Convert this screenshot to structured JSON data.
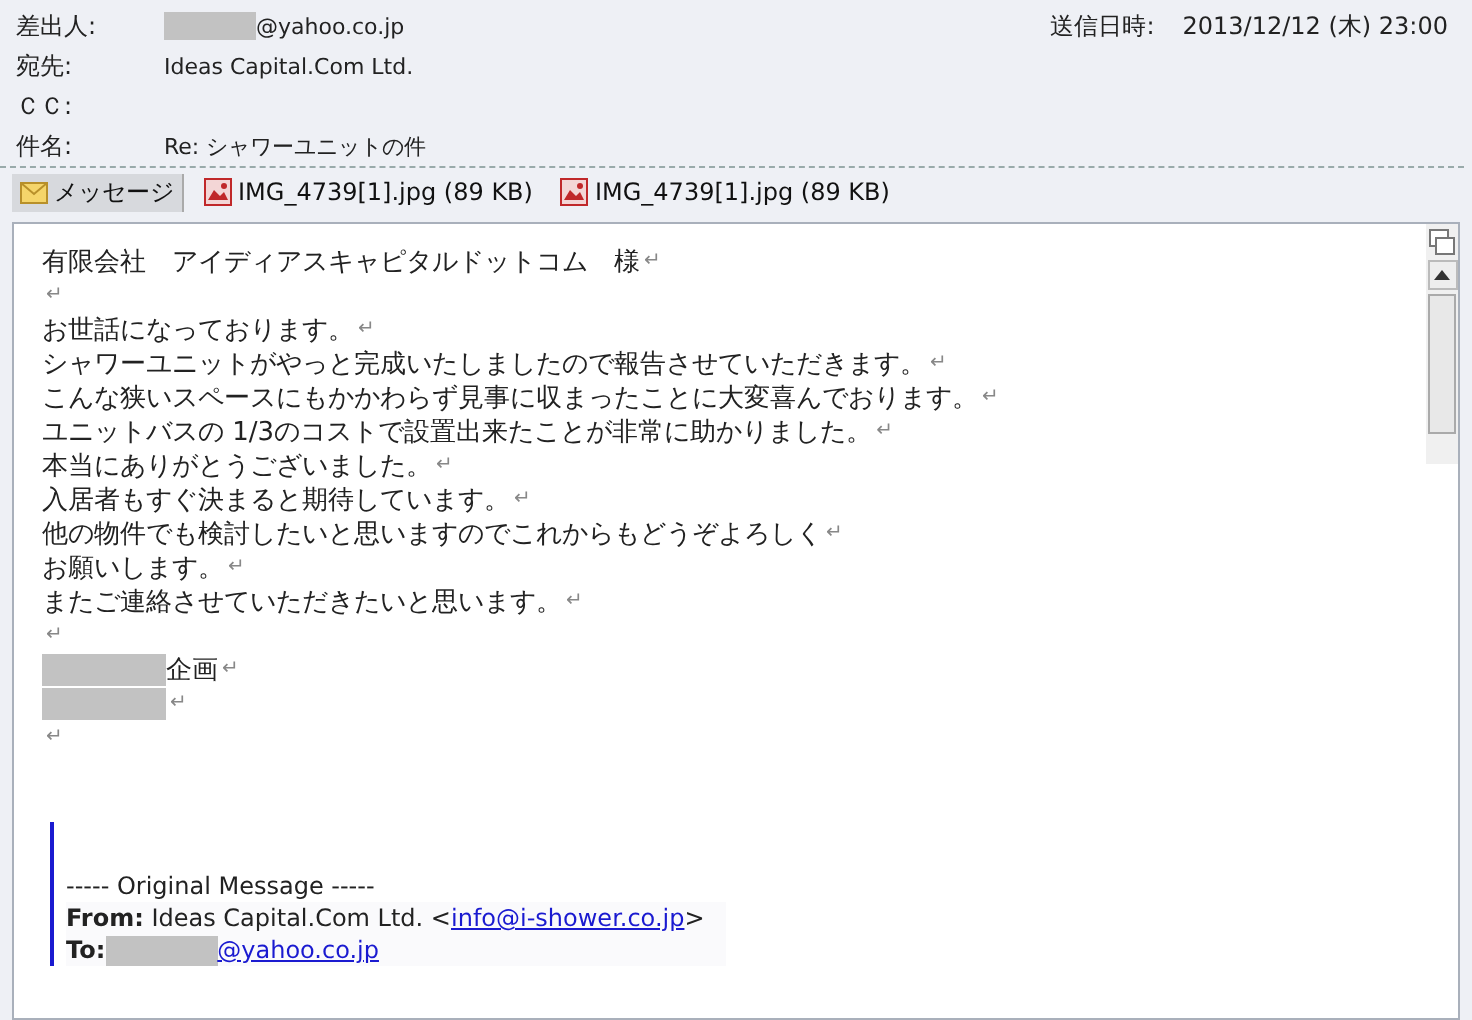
{
  "header": {
    "fields": [
      {
        "label": "差出人:",
        "value": "@yahoo.co.jp",
        "redacted": true
      },
      {
        "label": "宛先:",
        "value": "Ideas Capital.Com Ltd.",
        "redacted": false
      },
      {
        "label": "ＣＣ:",
        "redacted": false
      },
      {
        "label": "件名:",
        "value": "Re: シャワーユニットの件",
        "redacted": false
      }
    ],
    "sent_label": "送信日時:",
    "sent_value": "2013/12/12 (木) 23:00"
  },
  "tabs": [
    {
      "label": "メッセージ",
      "kind": "message",
      "selected": true
    },
    {
      "label": "IMG_4739[1].jpg (89 KB)",
      "kind": "image",
      "selected": false
    },
    {
      "label": "IMG_4739[1].jpg (89 KB)",
      "kind": "image",
      "selected": false
    }
  ],
  "body": {
    "lines": [
      {
        "text": "有限会社　アイディアスキャピタルドットコム　様",
        "mark": "↵",
        "redacted": false
      },
      {
        "mark": "↵",
        "redacted": false
      },
      {
        "text": "お世話になっております。",
        "mark": "↵",
        "redacted": false
      },
      {
        "text": "シャワーユニットがやっと完成いたしましたので報告させていただきます。",
        "mark": "↵",
        "redacted": false
      },
      {
        "text": "こんな狭いスペースにもかかわらず見事に収まったことに大変喜んでおります。",
        "mark": "↵",
        "redacted": false
      },
      {
        "text": "ユニットバスの 1/3のコストで設置出来たことが非常に助かりました。",
        "mark": "↵",
        "redacted": false
      },
      {
        "text": "本当にありがとうございました。",
        "mark": "↵",
        "redacted": false
      },
      {
        "text": "入居者もすぐ決まると期待しています。",
        "mark": "↵",
        "redacted": false
      },
      {
        "text": "他の物件でも検討したいと思いますのでこれからもどうぞよろしく",
        "mark": "↵",
        "redacted": false
      },
      {
        "text": "お願いします。",
        "mark": "↵",
        "redacted": false
      },
      {
        "text": "またご連絡させていただきたいと思います。",
        "mark": "↵",
        "redacted": false
      },
      {
        "mark": "↵",
        "redacted": false
      },
      {
        "text": "企画",
        "mark": "↵",
        "redacted": true
      },
      {
        "mark": "↵",
        "redacted": true
      },
      {
        "mark": "↵",
        "redacted": false
      }
    ],
    "original": {
      "separator": "----- Original Message -----",
      "from_label": "From:",
      "from_name": "Ideas Capital.Com Ltd. <",
      "from_link": "info@i-shower.co.jp",
      "from_end": ">",
      "to_label": "To:",
      "to_link": "@yahoo.co.jp",
      "to_redacted": true
    }
  }
}
